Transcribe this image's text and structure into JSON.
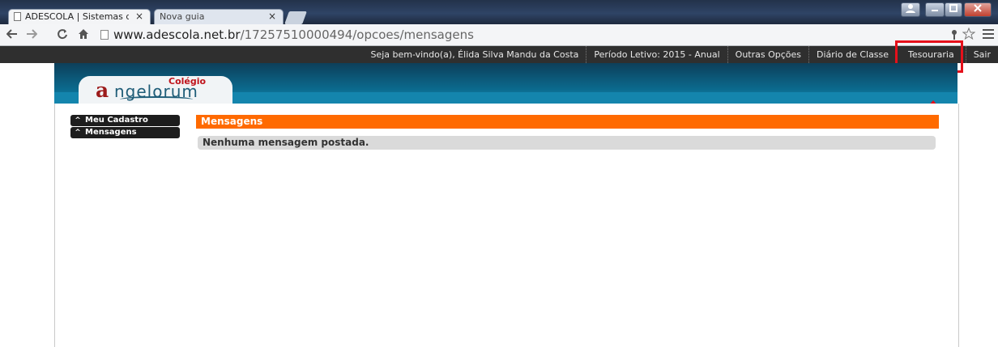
{
  "browser": {
    "tabs": [
      {
        "title": "ADESCOLA | Sistemas de G",
        "active": true
      },
      {
        "title": "Nova guia",
        "active": false
      }
    ],
    "tab_close_glyph": "×",
    "url_host": "www.adescola.net.br",
    "url_path": "/17257510000494/opcoes/mensagens",
    "icons": [
      "back-icon",
      "forward-icon",
      "reload-icon",
      "home-icon",
      "key-icon",
      "star-icon",
      "menu-icon"
    ],
    "window_buttons": [
      "minimize",
      "maximize",
      "close"
    ]
  },
  "topbar": {
    "welcome": "Seja bem-vindo(a), Élida Silva Mandu da Costa",
    "period": "Período Letivo: 2015 - Anual",
    "links": [
      "Outras Opções",
      "Diário de Classe",
      "Tesouraria",
      "Sair"
    ],
    "highlighted_link": "Tesouraria",
    "highlight_color": "#e5101b"
  },
  "logo": {
    "first_letter": "a",
    "name": "ngelorum",
    "tag": "Colégio"
  },
  "sidebar": {
    "items": [
      {
        "label": "Meu Cadastro"
      },
      {
        "label": "Mensagens"
      }
    ],
    "chevron": "^"
  },
  "main": {
    "section_title": "Mensagens",
    "empty_message": "Nenhuma mensagem postada.",
    "accent_color": "#ff6a00"
  }
}
